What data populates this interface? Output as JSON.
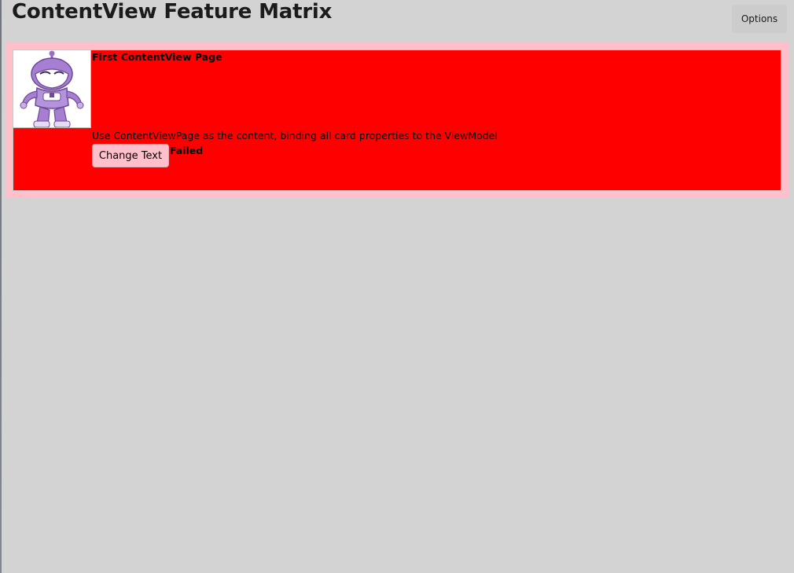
{
  "header": {
    "title": "ContentView Feature Matrix",
    "options_label": "Options"
  },
  "card": {
    "title": "First ContentView Page",
    "description": "Use ContentViewPage as the content, binding all card properties to the ViewModel",
    "button_label": "Change Text",
    "status": "Failed",
    "image_icon": "dotnet-bot-icon"
  },
  "colors": {
    "page_background": "#d3d3d3",
    "card_frame": "#ffc0cb",
    "card_background": "#ff0000",
    "button_background": "#ffc0cb"
  }
}
